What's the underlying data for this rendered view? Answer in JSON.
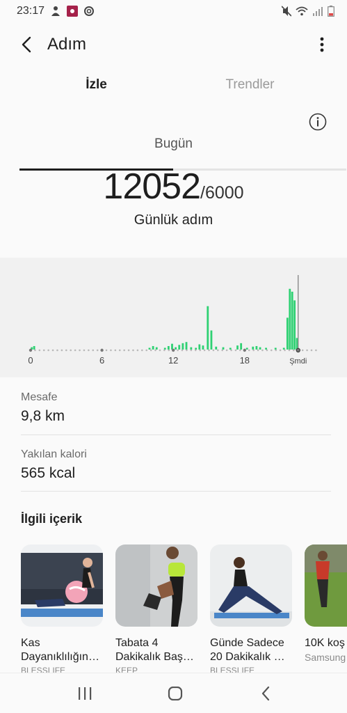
{
  "status_bar": {
    "time": "23:17",
    "icons_left": [
      "person-icon",
      "app-notification-icon",
      "sync-icon"
    ],
    "icons_right": [
      "mute-icon",
      "wifi-icon",
      "signal-icon",
      "battery-icon"
    ]
  },
  "app_bar": {
    "title": "Adım",
    "back_icon": "chevron-left-icon",
    "more_icon": "more-vert-icon"
  },
  "tabs": [
    {
      "label": "İzle",
      "active": true
    },
    {
      "label": "Trendler",
      "active": false
    }
  ],
  "summary": {
    "period": "Bugün",
    "steps": "12052",
    "goal": "/6000",
    "label": "Günlük adım"
  },
  "chart_data": {
    "type": "bar",
    "title": "",
    "xlabel": "",
    "ylabel": "",
    "x_tick_labels": [
      "0",
      "6",
      "12",
      "18",
      "Şmdi"
    ],
    "x_tick_hours": [
      0,
      6,
      12,
      18,
      22.5
    ],
    "now_hour": 22.5,
    "unit": "steps per 15 minutes",
    "ylim": [
      0,
      1300
    ],
    "bar_color": "#2fd173",
    "bars": [
      {
        "hour": 0.1,
        "value": 40
      },
      {
        "hour": 0.3,
        "value": 60
      },
      {
        "hour": 10.0,
        "value": 30
      },
      {
        "hour": 10.3,
        "value": 60
      },
      {
        "hour": 10.6,
        "value": 40
      },
      {
        "hour": 11.3,
        "value": 30
      },
      {
        "hour": 11.6,
        "value": 60
      },
      {
        "hour": 11.9,
        "value": 100
      },
      {
        "hour": 12.2,
        "value": 40
      },
      {
        "hour": 12.5,
        "value": 80
      },
      {
        "hour": 12.8,
        "value": 110
      },
      {
        "hour": 13.1,
        "value": 130
      },
      {
        "hour": 13.5,
        "value": 40
      },
      {
        "hour": 13.9,
        "value": 30
      },
      {
        "hour": 14.2,
        "value": 90
      },
      {
        "hour": 14.5,
        "value": 70
      },
      {
        "hour": 14.9,
        "value": 750
      },
      {
        "hour": 15.2,
        "value": 330
      },
      {
        "hour": 15.6,
        "value": 50
      },
      {
        "hour": 16.2,
        "value": 40
      },
      {
        "hour": 16.8,
        "value": 30
      },
      {
        "hour": 17.4,
        "value": 70
      },
      {
        "hour": 17.7,
        "value": 110
      },
      {
        "hour": 18.2,
        "value": 30
      },
      {
        "hour": 18.7,
        "value": 50
      },
      {
        "hour": 19.0,
        "value": 60
      },
      {
        "hour": 19.3,
        "value": 40
      },
      {
        "hour": 19.8,
        "value": 30
      },
      {
        "hour": 20.6,
        "value": 30
      },
      {
        "hour": 21.3,
        "value": 30
      },
      {
        "hour": 21.6,
        "value": 550
      },
      {
        "hour": 21.8,
        "value": 1050
      },
      {
        "hour": 22.0,
        "value": 1000
      },
      {
        "hour": 22.2,
        "value": 850
      },
      {
        "hour": 22.4,
        "value": 200
      }
    ]
  },
  "stats": [
    {
      "label": "Mesafe",
      "value": "9,8 km"
    },
    {
      "label": "Yakılan kalori",
      "value": "565 kcal"
    }
  ],
  "related": {
    "title": "İlgili içerik",
    "cards": [
      {
        "title": "Kas Dayanıklılığın…",
        "title_line2": "Dayanıklılığın…",
        "title_line1": "Kas",
        "source": "BLESSLIFE"
      },
      {
        "title_line1": "Tabata 4",
        "title_line2": "Dakikalık Baş…",
        "source": "KEEP"
      },
      {
        "title_line1": "Günde Sadece",
        "title_line2": "20 Dakikalık …",
        "source": "BLESSLIFE"
      },
      {
        "title_line1": "10K koş",
        "title_line2": "Samsung",
        "source": ""
      }
    ]
  },
  "nav_bar": {
    "icons": [
      "recent-apps-icon",
      "home-icon",
      "back-icon"
    ]
  }
}
